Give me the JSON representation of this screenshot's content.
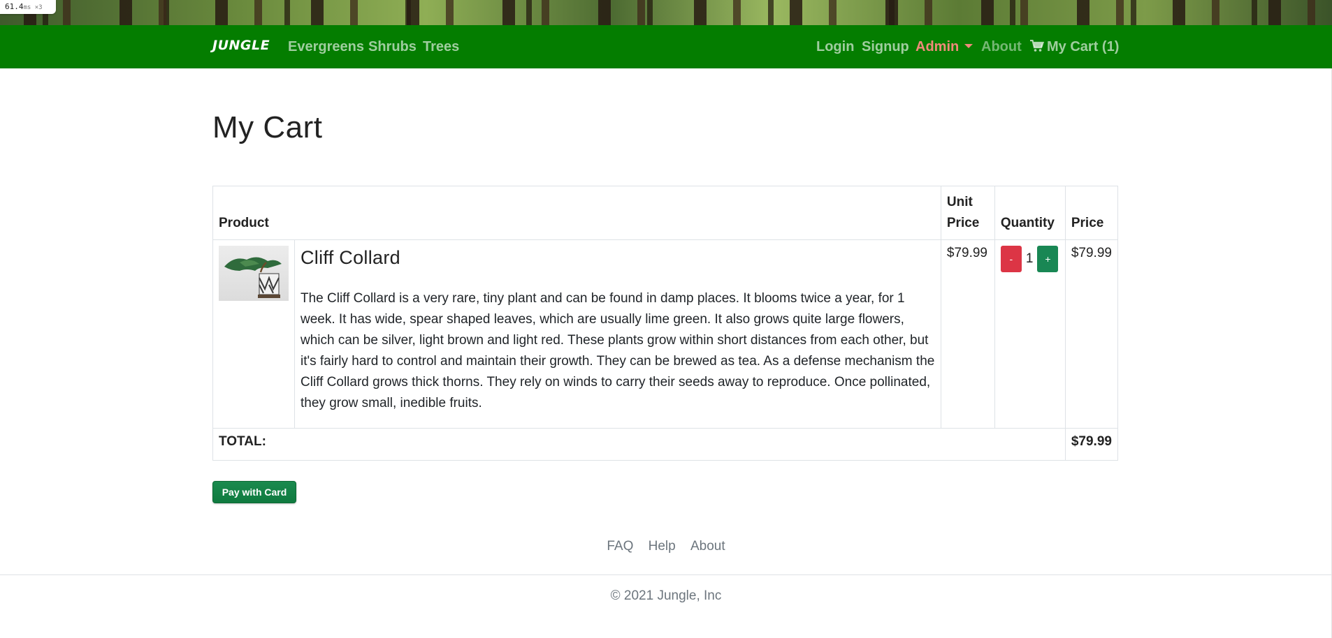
{
  "perf_badge": {
    "value": "61.4",
    "unit": "ms ×3"
  },
  "navbar": {
    "brand": "JUNGLE",
    "left_links": [
      "Evergreens",
      "Shrubs",
      "Trees"
    ],
    "login": "Login",
    "signup": "Signup",
    "admin": "Admin",
    "about": "About",
    "cart": "My Cart (1)",
    "colors": {
      "background": "#047d00",
      "admin": "#f08a7a"
    }
  },
  "main": {
    "title": "My Cart",
    "table": {
      "headers": {
        "product": "Product",
        "unit_price": "Unit Price",
        "quantity": "Quantity",
        "price": "Price"
      },
      "items": [
        {
          "name": "Cliff Collard",
          "image": "bonsai-plant-thumbnail",
          "description": "The Cliff Collard is a very rare, tiny plant and can be found in damp places. It blooms twice a year, for 1 week. It has wide, spear shaped leaves, which are usually lime green. It also grows quite large flowers, which can be silver, light brown and light red. These plants grow within short distances from each other, but it's fairly hard to control and maintain their growth. They can be brewed as tea. As a defense mechanism the Cliff Collard grows thick thorns. They rely on winds to carry their seeds away to reproduce. Once pollinated, they grow small, inedible fruits.",
          "unit_price": "$79.99",
          "quantity": "1",
          "minus_label": "-",
          "plus_label": "+",
          "price": "$79.99"
        }
      ],
      "total_label": "TOTAL:",
      "total_value": "$79.99"
    },
    "pay_button": "Pay with Card"
  },
  "footer": {
    "links": [
      "FAQ",
      "Help",
      "About"
    ],
    "copyright": "© 2021 Jungle, Inc"
  }
}
